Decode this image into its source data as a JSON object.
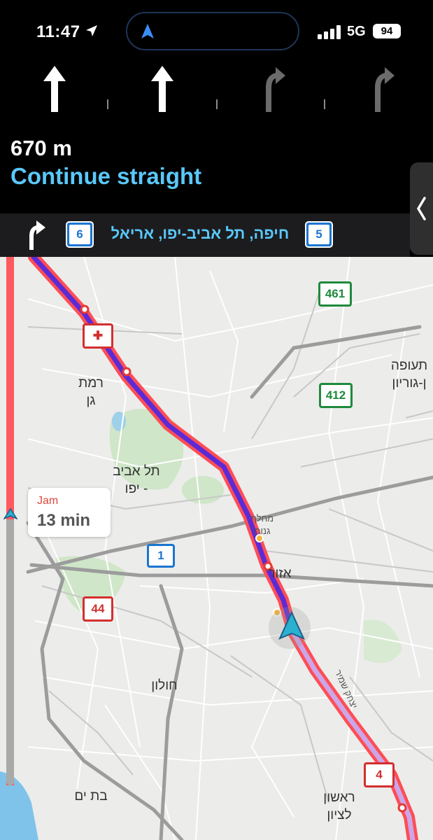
{
  "status_bar": {
    "time": "11:47",
    "network": "5G",
    "battery": "94"
  },
  "lanes": [
    {
      "icon": "straight-arrow-icon",
      "active": true
    },
    {
      "icon": "straight-arrow-icon",
      "active": true
    },
    {
      "icon": "turn-right-arrow-icon",
      "active": false
    },
    {
      "icon": "turn-right-arrow-icon",
      "active": false
    }
  ],
  "maneuver": {
    "distance": "670 m",
    "instruction": "Continue straight"
  },
  "sign": {
    "left_shield": "6",
    "text": "חיפה, תל אביב-יפו, אריאל",
    "right_shield": "5"
  },
  "eta": {
    "status": "Jam",
    "time": "13 min",
    "progress_fraction": 0.49
  },
  "map": {
    "places": {
      "ramat_gan": "רמת\nגן",
      "tel_aviv": "תל אביב\n- יפו",
      "holon": "חולון",
      "bat_yam": "בת ים",
      "rishon": "ראשון\nלציון",
      "azor": "אזור",
      "tfua": "תעופה\nן-גוריון",
      "mehlaf": "מחלף\nגנות",
      "street": "יצחק שמיר"
    },
    "shields": {
      "r461": "461",
      "r412": "412",
      "r1": "1",
      "r44": "44",
      "r4": "4",
      "r_top": "4"
    }
  },
  "colors": {
    "accent": "#5ac8fa",
    "route": "#5b2bd6",
    "traffic": "#ff4d55",
    "green_shield": "#1e8a3c",
    "blue_shield": "#1b75d0",
    "red_shield": "#d32f2f"
  }
}
